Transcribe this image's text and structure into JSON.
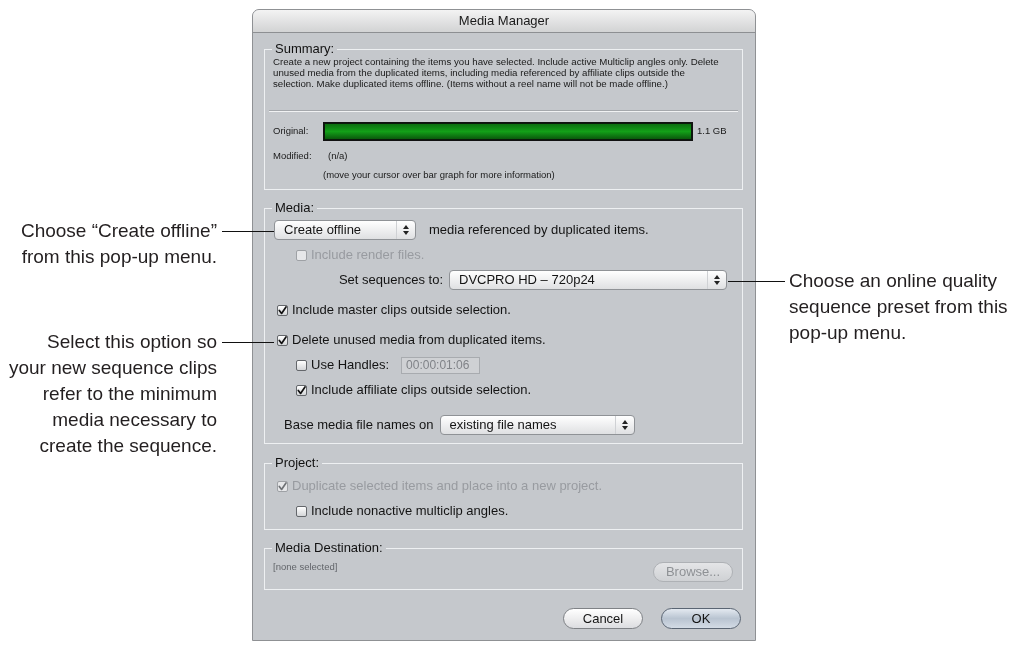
{
  "callouts_left": [
    {
      "lines": [
        "Choose “Create offline”",
        "from this pop-up menu."
      ]
    },
    {
      "lines": [
        "Select this option so",
        "your new sequence clips",
        "refer to the minimum",
        "media necessary to",
        "create the sequence."
      ]
    }
  ],
  "dialog": {
    "title": "Media Manager",
    "summary": {
      "label": "Summary:",
      "description": "Create a new project containing the items you have selected. Include active Multiclip angles only. Delete unused media from the duplicated items, including media referenced by affiliate clips outside the selection. Make duplicated items offline. (Items without a reel name will not be made offline.)",
      "original": {
        "label": "Original:",
        "level": 1,
        "size": "1.1 GB"
      },
      "modified": {
        "label": "Modified:",
        "value": "(n/a)"
      },
      "hint": "(move your cursor over bar graph for more information)"
    },
    "media": {
      "label": "Media:",
      "rows": [
        {
          "kind": "popup",
          "value": "Create offline",
          "text": "media referenced by duplicated items.",
          "children": [
            {
              "kind": "checkbox",
              "label": "Include render files.",
              "checked": false,
              "disabled": true
            },
            {
              "kind": "labeled_popup",
              "label": "Set sequences to:",
              "value": "DVCPRO HD – 720p24"
            }
          ]
        },
        {
          "kind": "checkbox",
          "label": "Include master clips outside selection.",
          "checked": true,
          "disabled": false
        },
        {
          "kind": "checkbox",
          "label": "Delete unused media from duplicated items.",
          "checked": true,
          "disabled": false,
          "children": [
            {
              "kind": "checkbox_field",
              "label": "Use Handles:",
              "checked": false,
              "disabled": false,
              "field": {
                "value": "00:00:01:06",
                "disabled": true
              }
            },
            {
              "kind": "checkbox",
              "label": "Include affiliate clips outside selection.",
              "checked": true,
              "disabled": false
            }
          ]
        },
        {
          "kind": "labeled_popup",
          "label": "Base media file names on",
          "value": "existing file names"
        }
      ]
    },
    "project": {
      "label": "Project:",
      "rows": [
        {
          "kind": "checkbox",
          "label": "Duplicate selected items and place into a new project.",
          "checked": true,
          "disabled": true,
          "children": [
            {
              "kind": "checkbox",
              "label": "Include nonactive multiclip angles.",
              "checked": false,
              "disabled": false
            }
          ]
        }
      ]
    },
    "media_destination": {
      "label": "Media Destination:",
      "path": "[none selected]",
      "browse_button": {
        "label": "Browse...",
        "disabled": true
      }
    },
    "buttons": [
      {
        "label": "Cancel",
        "default": false
      },
      {
        "label": "OK",
        "default": true
      }
    ]
  },
  "callouts_right": [
    {
      "lines": [
        "Choose an online quality",
        "sequence preset from this",
        "pop-up menu."
      ]
    }
  ]
}
